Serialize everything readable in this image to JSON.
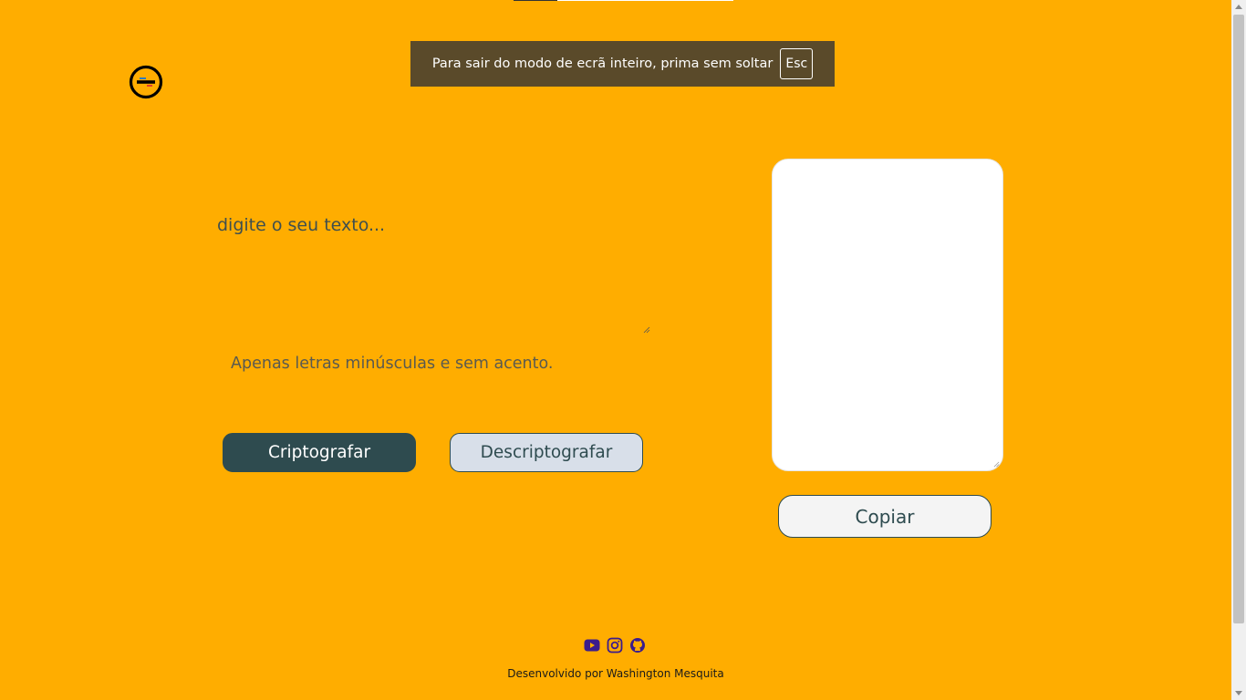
{
  "fullscreen_notice": {
    "message": "Para sair do modo de ecrã inteiro, prima sem soltar",
    "key": "Esc"
  },
  "logo": {
    "icon": "alura-logo-icon"
  },
  "encryptor": {
    "input_placeholder": "digite o seu texto...",
    "input_value": "",
    "hint": "Apenas letras minúsculas e sem acento.",
    "encrypt_label": "Criptografar",
    "decrypt_label": "Descriptografar"
  },
  "output": {
    "value": "",
    "copy_label": "Copiar"
  },
  "footer": {
    "social_icons": [
      "youtube-icon",
      "instagram-icon",
      "github-icon"
    ],
    "credit": "Desenvolvido por Washington Mesquita"
  },
  "colors": {
    "background": "#FFAD00",
    "primary": "#2E4B4F",
    "secondary_button": "#D8DFE9",
    "social_icons": "#3B1C8C"
  }
}
